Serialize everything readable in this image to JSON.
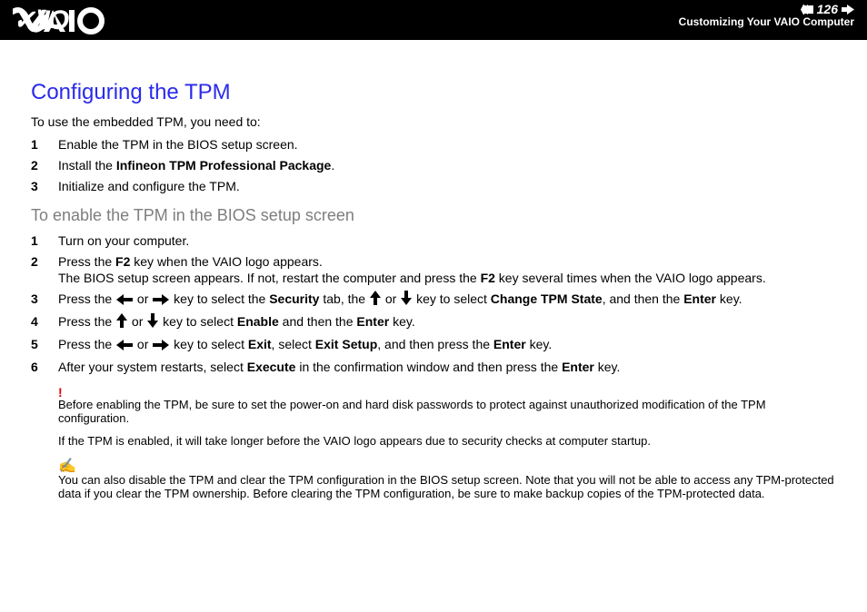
{
  "header": {
    "page_number": "126",
    "section": "Customizing Your VAIO Computer"
  },
  "title": "Configuring the TPM",
  "intro": "To use the embedded TPM, you need to:",
  "summary_steps": {
    "s1": "Enable the TPM in the BIOS setup screen.",
    "s2_pre": "Install the ",
    "s2_bold": "Infineon TPM Professional Package",
    "s2_post": ".",
    "s3": "Initialize and configure the TPM."
  },
  "subhead": "To enable the TPM in the BIOS setup screen",
  "detail_steps": {
    "d1": "Turn on your computer.",
    "d2a": "Press the ",
    "d2b": "F2",
    "d2c": " key when the VAIO logo appears.",
    "d2line2a": "The BIOS setup screen appears. If not, restart the computer and press the ",
    "d2line2b": "F2",
    "d2line2c": " key several times when the VAIO logo appears.",
    "d3a": "Press the ",
    "d3or1": " or ",
    "d3b": " key to select the ",
    "d3sec": "Security",
    "d3c": " tab, the ",
    "d3or2": " or ",
    "d3d": " key to select ",
    "d3chg": "Change TPM State",
    "d3e": ", and then the ",
    "d3enter": "Enter",
    "d3f": " key.",
    "d4a": "Press the ",
    "d4or": " or ",
    "d4b": " key to select ",
    "d4en": "Enable",
    "d4c": " and then the ",
    "d4enter": "Enter",
    "d4d": " key.",
    "d5a": "Press the ",
    "d5or": " or ",
    "d5b": " key to select ",
    "d5exit": "Exit",
    "d5c": ", select ",
    "d5es": "Exit Setup",
    "d5d": ", and then press the ",
    "d5enter": "Enter",
    "d5e": " key.",
    "d6a": "After your system restarts, select ",
    "d6exec": "Execute",
    "d6b": " in the confirmation window and then press the ",
    "d6enter": "Enter",
    "d6c": " key."
  },
  "warning": "Before enabling the TPM, be sure to set the power-on and hard disk passwords to protect against unauthorized modification of the TPM configuration.",
  "info": "If the TPM is enabled, it will take longer before the VAIO logo appears due to security checks at computer startup.",
  "note": "You can also disable the TPM and clear the TPM configuration in the BIOS setup screen. Note that you will not be able to access any TPM-protected data if you clear the TPM ownership. Before clearing the TPM configuration, be sure to make backup copies of the TPM-protected data."
}
